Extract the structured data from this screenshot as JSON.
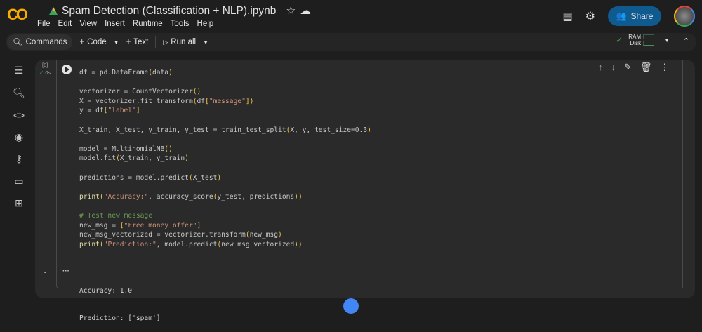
{
  "app": {
    "logo": "CO",
    "title": "Spam Detection (Classification + NLP).ipynb"
  },
  "menu": [
    "File",
    "Edit",
    "View",
    "Insert",
    "Runtime",
    "Tools",
    "Help"
  ],
  "header": {
    "share_label": "Share"
  },
  "toolbar": {
    "commands": "Commands",
    "code": "Code",
    "text": "Text",
    "run_all": "Run all"
  },
  "resources": {
    "ram": "RAM",
    "disk": "Disk",
    "status_color": "#34a853"
  },
  "sidebar": [
    "table-of-contents",
    "find",
    "code-snippets",
    "variables",
    "secrets",
    "files",
    "data-table"
  ],
  "cell": {
    "exec_count": "[8]",
    "exec_time": "0s",
    "code": [
      [
        [
          "df = pd.DataFrame",
          "kw"
        ],
        [
          "(",
          "paren"
        ],
        [
          "data",
          "kw"
        ],
        [
          ")",
          "paren"
        ]
      ],
      [],
      [
        [
          "vectorizer = CountVectorizer",
          "kw"
        ],
        [
          "()",
          "paren"
        ]
      ],
      [
        [
          "X = vectorizer.fit_transform",
          "kw"
        ],
        [
          "(",
          "paren"
        ],
        [
          "df",
          "kw"
        ],
        [
          "[",
          "paren"
        ],
        [
          "\"message\"",
          "str"
        ],
        [
          "])",
          "paren"
        ]
      ],
      [
        [
          "y = df",
          "kw"
        ],
        [
          "[",
          "paren"
        ],
        [
          "\"label\"",
          "str"
        ],
        [
          "]",
          "paren"
        ]
      ],
      [],
      [
        [
          "X_train, X_test, y_train, y_test = train_test_split",
          "kw"
        ],
        [
          "(",
          "paren"
        ],
        [
          "X, y, test_size=0.3",
          "kw"
        ],
        [
          ")",
          "paren"
        ]
      ],
      [],
      [
        [
          "model = MultinomialNB",
          "kw"
        ],
        [
          "()",
          "paren"
        ]
      ],
      [
        [
          "model.fit",
          "kw"
        ],
        [
          "(",
          "paren"
        ],
        [
          "X_train, y_train",
          "kw"
        ],
        [
          ")",
          "paren"
        ]
      ],
      [],
      [
        [
          "predictions = model.predict",
          "kw"
        ],
        [
          "(",
          "paren"
        ],
        [
          "X_test",
          "kw"
        ],
        [
          ")",
          "paren"
        ]
      ],
      [],
      [
        [
          "print",
          "fn"
        ],
        [
          "(",
          "paren"
        ],
        [
          "\"Accuracy:\"",
          "str"
        ],
        [
          ", accuracy_score",
          "kw"
        ],
        [
          "(",
          "paren"
        ],
        [
          "y_test, predictions",
          "kw"
        ],
        [
          "))",
          "paren"
        ]
      ],
      [],
      [
        [
          "# Test new message",
          "com"
        ]
      ],
      [
        [
          "new_msg = ",
          "kw"
        ],
        [
          "[",
          "paren"
        ],
        [
          "\"Free money offer\"",
          "str"
        ],
        [
          "]",
          "paren"
        ]
      ],
      [
        [
          "new_msg_vectorized = vectorizer.transform",
          "kw"
        ],
        [
          "(",
          "paren"
        ],
        [
          "new_msg",
          "kw"
        ],
        [
          ")",
          "paren"
        ]
      ],
      [
        [
          "print",
          "fn"
        ],
        [
          "(",
          "paren"
        ],
        [
          "\"Prediction:\"",
          "str"
        ],
        [
          ", model.predict",
          "kw"
        ],
        [
          "(",
          "paren"
        ],
        [
          "new_msg_vectorized",
          "kw"
        ],
        [
          "))",
          "paren"
        ]
      ]
    ],
    "output": [
      "Accuracy: 1.0",
      "Prediction: ['spam']"
    ]
  }
}
